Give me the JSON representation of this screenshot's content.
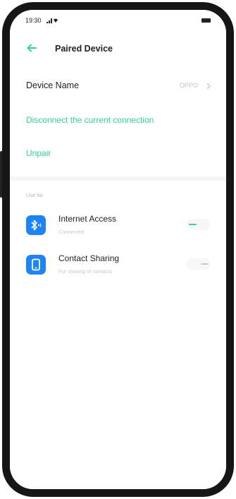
{
  "status_bar": {
    "time": "19:30"
  },
  "app_bar": {
    "title": "Paired Device"
  },
  "device": {
    "label": "Device Name",
    "value": "OPPO"
  },
  "actions": {
    "disconnect": "Disconnect the current connection",
    "unpair": "Unpair"
  },
  "section": {
    "label": "Use for"
  },
  "items": [
    {
      "title": "Internet Access",
      "subtitle": "Connected",
      "icon": "bluetooth-icon",
      "enabled": true
    },
    {
      "title": "Contact Sharing",
      "subtitle": "For sharing of contacts",
      "icon": "phone-icon",
      "enabled": false
    }
  ],
  "colors": {
    "accent": "#2fd19c",
    "icon_bg": "#1e83f5"
  }
}
